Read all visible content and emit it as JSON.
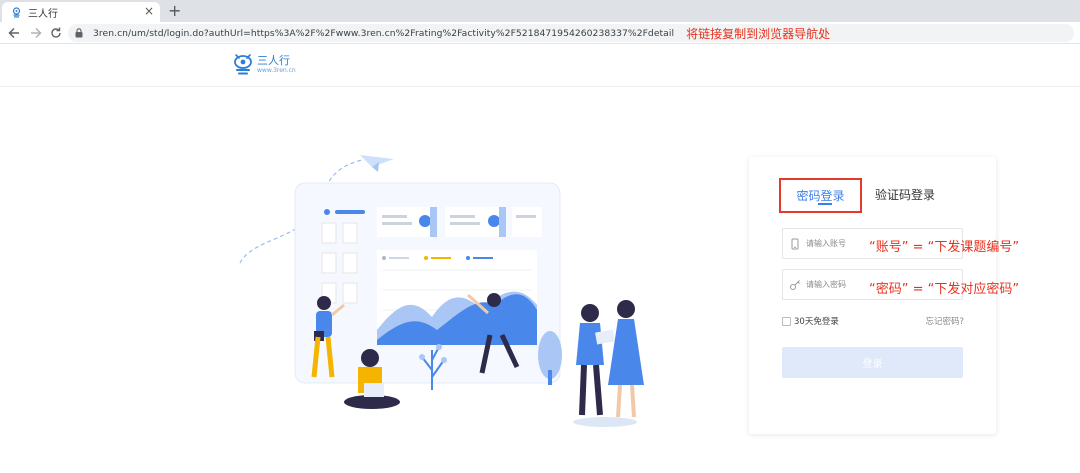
{
  "browser": {
    "tab_title": "三人行",
    "tab_close": "×",
    "new_tab": "+",
    "url": "3ren.cn/um/std/login.do?authUrl=https%3A%2F%2Fwww.3ren.cn%2Frating%2Factivity%2F5218471954260238337%2Fdetail",
    "url_annotation": "将链接复制到浏览器导航处"
  },
  "site": {
    "logo_name": "三人行",
    "logo_domain": "www.3ren.cn"
  },
  "login": {
    "tabs": [
      {
        "label": "密码登录",
        "active": true
      },
      {
        "label": "验证码登录",
        "active": false
      }
    ],
    "username_placeholder": "请输入账号",
    "password_placeholder": "请输入密码",
    "remember_label": "30天免登录",
    "forgot_label": "忘记密码?",
    "submit_label": "登录"
  },
  "annotations": {
    "account_hint": "“账号” = “下发课题编号”",
    "password_hint": "“密码” = “下发对应密码”"
  },
  "colors": {
    "accent": "#3d80e8",
    "annotation": "#e8321e",
    "highlight_border": "#e33a2c",
    "button_disabled": "#dfe9f9"
  }
}
